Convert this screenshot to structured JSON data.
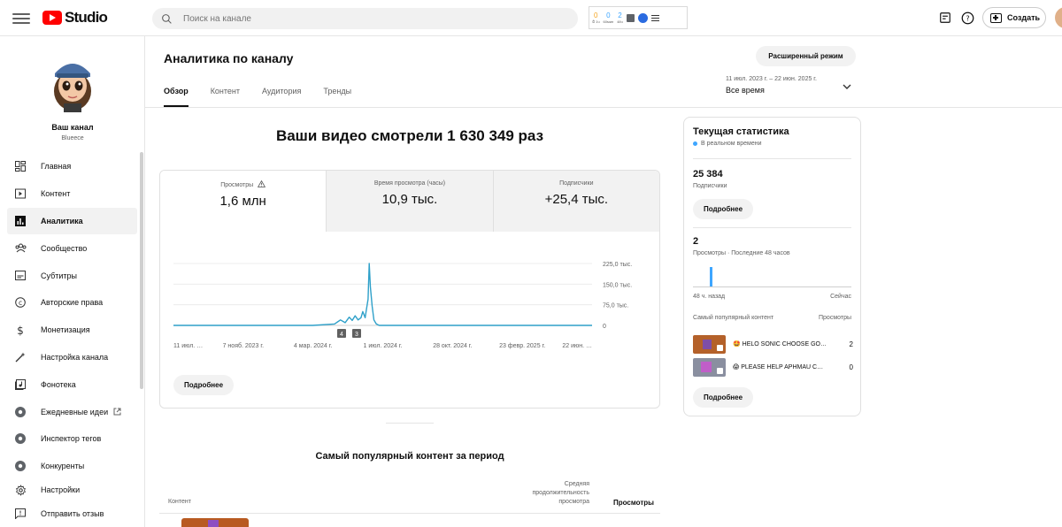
{
  "app": {
    "logo_text": "Studio"
  },
  "search": {
    "placeholder": "Поиск на канале"
  },
  "extension": {
    "stats": [
      {
        "value": "0",
        "label": "⏱ 1ч",
        "color": "#f5a623"
      },
      {
        "value": "0",
        "label": "60мин",
        "color": "#3ea6ff"
      },
      {
        "value": "2",
        "label": "48ч",
        "color": "#3ea6ff"
      }
    ]
  },
  "header": {
    "create_label": "Создать"
  },
  "channel": {
    "name": "Ваш канал",
    "handle": "Blueece"
  },
  "sidebar": {
    "items": [
      {
        "label": "Главная",
        "icon": "dashboard-icon"
      },
      {
        "label": "Контент",
        "icon": "content-icon"
      },
      {
        "label": "Аналитика",
        "icon": "analytics-icon",
        "active": true
      },
      {
        "label": "Сообщество",
        "icon": "community-icon"
      },
      {
        "label": "Субтитры",
        "icon": "subtitles-icon"
      },
      {
        "label": "Авторские права",
        "icon": "copyright-icon"
      },
      {
        "label": "Монетизация",
        "icon": "monetization-icon"
      },
      {
        "label": "Настройка канала",
        "icon": "customization-icon"
      },
      {
        "label": "Фонотека",
        "icon": "audio-library-icon"
      },
      {
        "label": "Ежедневные идеи",
        "icon": "ideas-icon",
        "external": true
      },
      {
        "label": "Инспектор тегов",
        "icon": "tag-inspector-icon"
      },
      {
        "label": "Конкуренты",
        "icon": "competitors-icon"
      },
      {
        "label": "Настройки",
        "icon": "settings-icon"
      },
      {
        "label": "Отправить отзыв",
        "icon": "feedback-icon"
      }
    ]
  },
  "page": {
    "title": "Аналитика по каналу",
    "tabs": [
      "Обзор",
      "Контент",
      "Аудитория",
      "Тренды"
    ],
    "advanced_mode_label": "Расширенный режим",
    "date_range": {
      "range": "11 июл. 2023 г. – 22 июн. 2025 г.",
      "label": "Все время"
    }
  },
  "overview": {
    "headline": "Ваши видео смотрели 1 630 349 раз",
    "metrics": [
      {
        "title": "Просмотры",
        "value": "1,6 млн",
        "warning": true
      },
      {
        "title": "Время просмотра (часы)",
        "value": "10,9 тыс."
      },
      {
        "title": "Подписчики",
        "value": "+25,4 тыс."
      }
    ],
    "more_label": "Подробнее"
  },
  "chart_data": {
    "type": "line",
    "series": [
      {
        "x": [
          "2023-07-11",
          "2023-09-01",
          "2023-11-07",
          "2024-01-01",
          "2024-03-04",
          "2024-04-10",
          "2024-04-20",
          "2024-04-28",
          "2024-05-05",
          "2024-05-10",
          "2024-05-15",
          "2024-05-20",
          "2024-05-25",
          "2024-05-28",
          "2024-06-01",
          "2024-06-03",
          "2024-06-06",
          "2024-06-08",
          "2024-06-10",
          "2024-06-13",
          "2024-06-16",
          "2024-06-20",
          "2024-06-25",
          "2024-07-01",
          "2024-08-15",
          "2024-10-28",
          "2025-01-01",
          "2025-02-23",
          "2025-06-22"
        ],
        "y": [
          0,
          0,
          0,
          0,
          0,
          5000,
          20000,
          10000,
          30000,
          18000,
          35000,
          20000,
          28000,
          50000,
          28000,
          55000,
          95000,
          225000,
          140000,
          70000,
          20000,
          5000,
          0,
          0,
          0,
          0,
          0,
          0,
          0
        ]
      }
    ],
    "x_tick_labels": [
      "11 июл. …",
      "7 нояб. 2023 г.",
      "4 мар. 2024 г.",
      "1 июл. 2024 г.",
      "28 окт. 2024 г.",
      "23 февр. 2025 г.",
      "22 июн. …"
    ],
    "y_tick_labels": [
      "0",
      "75,0 тыс.",
      "150,0 тыс.",
      "225,0 тыс."
    ],
    "ylim": [
      0,
      225000
    ],
    "grid": true,
    "annotations": [
      "4",
      "3"
    ]
  },
  "realtime": {
    "title": "Текущая статистика",
    "live_label": "В реальном времени",
    "subscribers": {
      "value": "25 384",
      "label": "Подписчики"
    },
    "views": {
      "value": "2",
      "label": "Просмотры · Последние 48 часов"
    },
    "axis_start": "48 ч. назад",
    "axis_end": "Сейчас",
    "top_header": "Самый популярный контент",
    "top_header_views": "Просмотры",
    "top_items": [
      {
        "title": "🤩 HELO SONIC CHOOSE GO…",
        "views": "2"
      },
      {
        "title": "😱 PLEASE HELP APHMAU C…",
        "views": "0"
      }
    ],
    "more_label": "Подробнее"
  },
  "top_content": {
    "title": "Самый популярный контент за период",
    "col_content": "Контент",
    "col_avg_duration": "Средняя продолжительность просмотра",
    "col_views": "Просмотры"
  },
  "colors": {
    "accent": "#3ea6ff",
    "line": "#2ea0c9",
    "youtube_red": "#ff0000"
  }
}
